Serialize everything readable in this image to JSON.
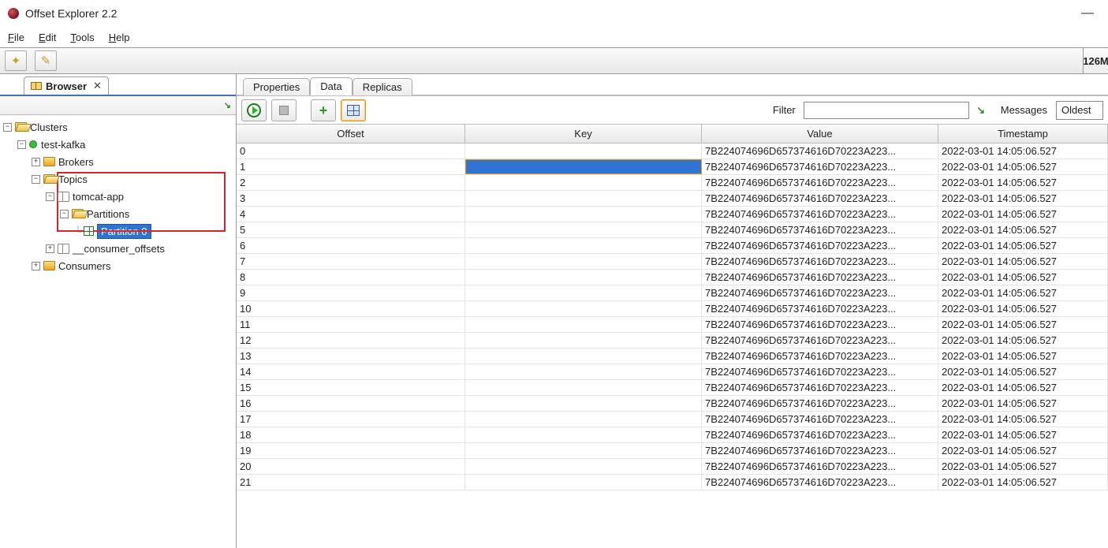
{
  "app": {
    "title": "Offset Explorer  2.2",
    "memory": "126M"
  },
  "menu": {
    "file": "File",
    "edit": "Edit",
    "tools": "Tools",
    "help": "Help"
  },
  "browser_tab": {
    "label": "Browser"
  },
  "tree": {
    "root": "Clusters",
    "cluster": "test-kafka",
    "brokers": "Brokers",
    "topics": "Topics",
    "topic": "tomcat-app",
    "partitions": "Partitions",
    "partition": "Partition 0",
    "consumer_offsets": "__consumer_offsets",
    "consumers": "Consumers"
  },
  "right_tabs": {
    "properties": "Properties",
    "data": "Data",
    "replicas": "Replicas"
  },
  "filter": {
    "label": "Filter",
    "value": "",
    "messages_label": "Messages",
    "messages_mode": "Oldest"
  },
  "columns": {
    "offset": "Offset",
    "key": "Key",
    "value": "Value",
    "timestamp": "Timestamp"
  },
  "selected_row": 1,
  "rows": [
    {
      "offset": "0",
      "key": "",
      "value": "7B224074696D657374616D70223A223...",
      "ts": "2022-03-01 14:05:06.527"
    },
    {
      "offset": "1",
      "key": "",
      "value": "7B224074696D657374616D70223A223...",
      "ts": "2022-03-01 14:05:06.527"
    },
    {
      "offset": "2",
      "key": "",
      "value": "7B224074696D657374616D70223A223...",
      "ts": "2022-03-01 14:05:06.527"
    },
    {
      "offset": "3",
      "key": "",
      "value": "7B224074696D657374616D70223A223...",
      "ts": "2022-03-01 14:05:06.527"
    },
    {
      "offset": "4",
      "key": "",
      "value": "7B224074696D657374616D70223A223...",
      "ts": "2022-03-01 14:05:06.527"
    },
    {
      "offset": "5",
      "key": "",
      "value": "7B224074696D657374616D70223A223...",
      "ts": "2022-03-01 14:05:06.527"
    },
    {
      "offset": "6",
      "key": "",
      "value": "7B224074696D657374616D70223A223...",
      "ts": "2022-03-01 14:05:06.527"
    },
    {
      "offset": "7",
      "key": "",
      "value": "7B224074696D657374616D70223A223...",
      "ts": "2022-03-01 14:05:06.527"
    },
    {
      "offset": "8",
      "key": "",
      "value": "7B224074696D657374616D70223A223...",
      "ts": "2022-03-01 14:05:06.527"
    },
    {
      "offset": "9",
      "key": "",
      "value": "7B224074696D657374616D70223A223...",
      "ts": "2022-03-01 14:05:06.527"
    },
    {
      "offset": "10",
      "key": "",
      "value": "7B224074696D657374616D70223A223...",
      "ts": "2022-03-01 14:05:06.527"
    },
    {
      "offset": "11",
      "key": "",
      "value": "7B224074696D657374616D70223A223...",
      "ts": "2022-03-01 14:05:06.527"
    },
    {
      "offset": "12",
      "key": "",
      "value": "7B224074696D657374616D70223A223...",
      "ts": "2022-03-01 14:05:06.527"
    },
    {
      "offset": "13",
      "key": "",
      "value": "7B224074696D657374616D70223A223...",
      "ts": "2022-03-01 14:05:06.527"
    },
    {
      "offset": "14",
      "key": "",
      "value": "7B224074696D657374616D70223A223...",
      "ts": "2022-03-01 14:05:06.527"
    },
    {
      "offset": "15",
      "key": "",
      "value": "7B224074696D657374616D70223A223...",
      "ts": "2022-03-01 14:05:06.527"
    },
    {
      "offset": "16",
      "key": "",
      "value": "7B224074696D657374616D70223A223...",
      "ts": "2022-03-01 14:05:06.527"
    },
    {
      "offset": "17",
      "key": "",
      "value": "7B224074696D657374616D70223A223...",
      "ts": "2022-03-01 14:05:06.527"
    },
    {
      "offset": "18",
      "key": "",
      "value": "7B224074696D657374616D70223A223...",
      "ts": "2022-03-01 14:05:06.527"
    },
    {
      "offset": "19",
      "key": "",
      "value": "7B224074696D657374616D70223A223...",
      "ts": "2022-03-01 14:05:06.527"
    },
    {
      "offset": "20",
      "key": "",
      "value": "7B224074696D657374616D70223A223...",
      "ts": "2022-03-01 14:05:06.527"
    },
    {
      "offset": "21",
      "key": "",
      "value": "7B224074696D657374616D70223A223...",
      "ts": "2022-03-01 14:05:06.527"
    }
  ]
}
